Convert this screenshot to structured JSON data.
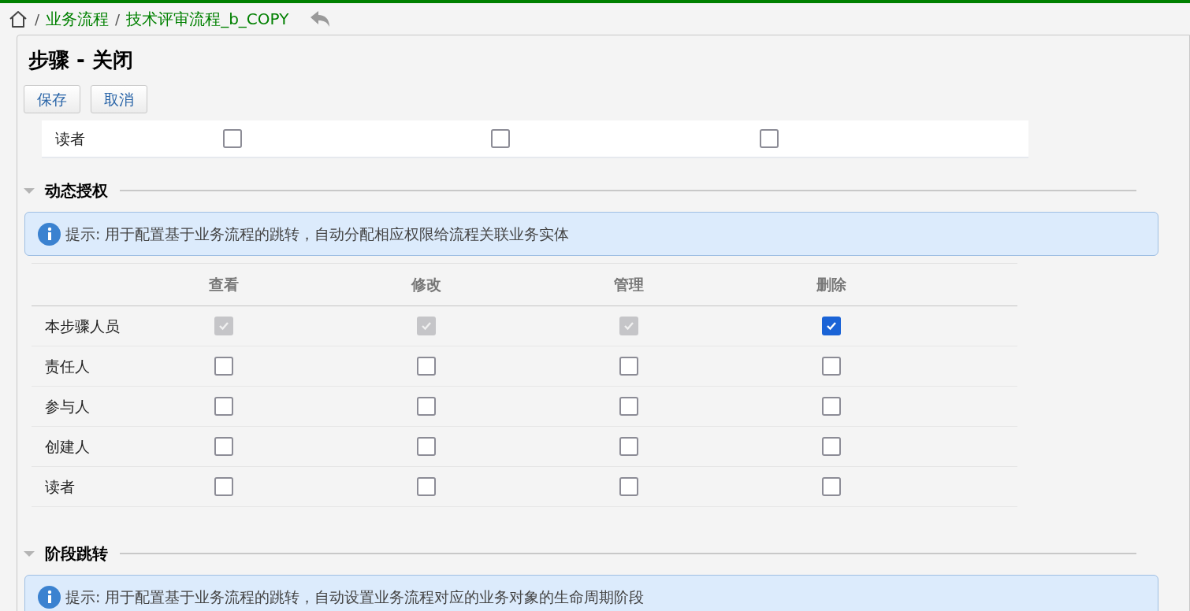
{
  "breadcrumb": {
    "items": [
      "业务流程",
      "技术评审流程_b_COPY"
    ],
    "separator": "/"
  },
  "page_title": "步骤 - 关闭",
  "buttons": [
    "保存",
    "取消"
  ],
  "top_table": {
    "rows": [
      {
        "label": "读者",
        "cells": [
          {
            "checked": false,
            "disabled": false
          },
          {
            "checked": false,
            "disabled": false
          },
          {
            "checked": false,
            "disabled": false
          }
        ]
      }
    ]
  },
  "sections": [
    {
      "title": "动态授权",
      "expanded": true,
      "tip": "提示: 用于配置基于业务流程的跳转，自动分配相应权限给流程关联业务实体",
      "table": {
        "columns": [
          "查看",
          "修改",
          "管理",
          "删除"
        ],
        "rows": [
          {
            "label": "本步骤人员",
            "cells": [
              {
                "checked": true,
                "disabled": true
              },
              {
                "checked": true,
                "disabled": true
              },
              {
                "checked": true,
                "disabled": true
              },
              {
                "checked": true,
                "disabled": false
              }
            ]
          },
          {
            "label": "责任人",
            "cells": [
              {
                "checked": false,
                "disabled": false
              },
              {
                "checked": false,
                "disabled": false
              },
              {
                "checked": false,
                "disabled": false
              },
              {
                "checked": false,
                "disabled": false
              }
            ]
          },
          {
            "label": "参与人",
            "cells": [
              {
                "checked": false,
                "disabled": false
              },
              {
                "checked": false,
                "disabled": false
              },
              {
                "checked": false,
                "disabled": false
              },
              {
                "checked": false,
                "disabled": false
              }
            ]
          },
          {
            "label": "创建人",
            "cells": [
              {
                "checked": false,
                "disabled": false
              },
              {
                "checked": false,
                "disabled": false
              },
              {
                "checked": false,
                "disabled": false
              },
              {
                "checked": false,
                "disabled": false
              }
            ]
          },
          {
            "label": "读者",
            "cells": [
              {
                "checked": false,
                "disabled": false
              },
              {
                "checked": false,
                "disabled": false
              },
              {
                "checked": false,
                "disabled": false
              },
              {
                "checked": false,
                "disabled": false
              }
            ]
          }
        ]
      }
    },
    {
      "title": "阶段跳转",
      "expanded": true,
      "tip": "提示: 用于配置基于业务流程的跳转，自动设置业务流程对应的业务对象的生命周期阶段"
    }
  ]
}
